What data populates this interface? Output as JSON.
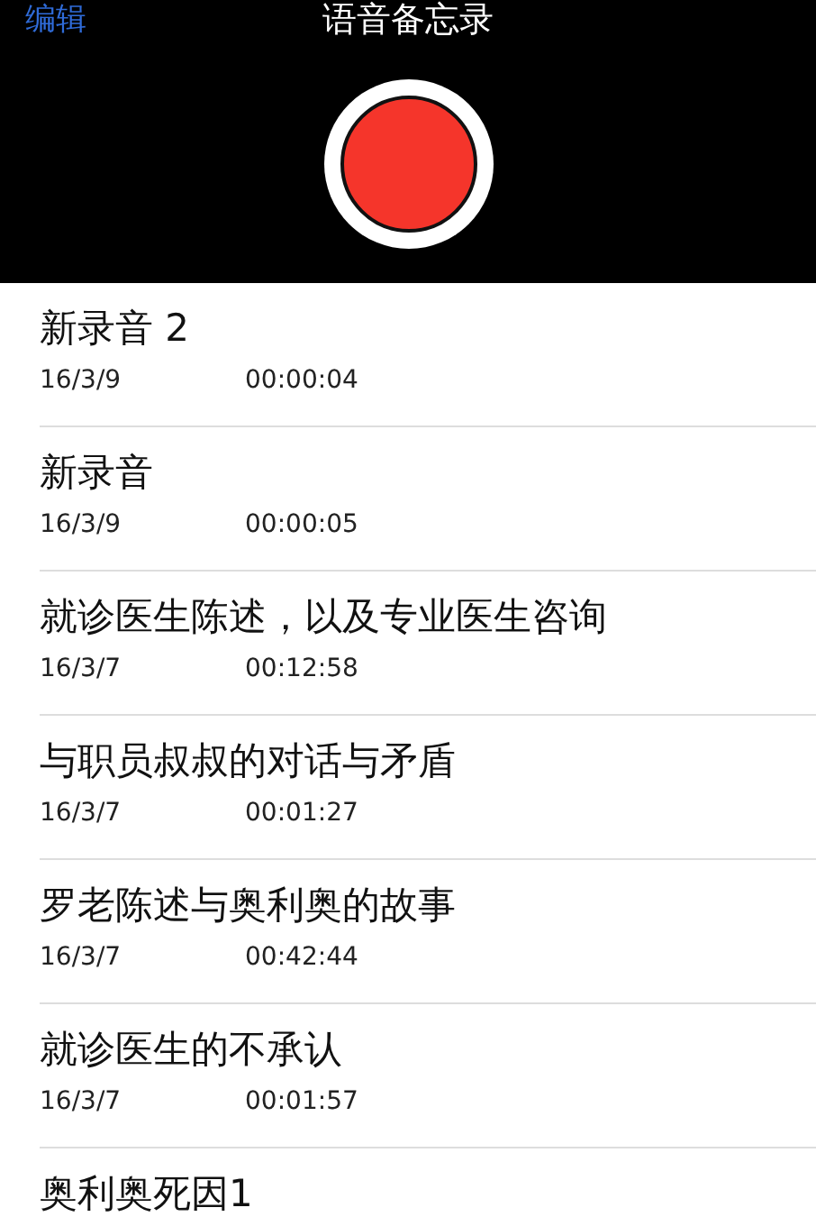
{
  "header": {
    "edit": "编辑",
    "title": "语音备忘录"
  },
  "recordings": [
    {
      "title": "新录音 2",
      "date": "16/3/9",
      "duration": "00:00:04"
    },
    {
      "title": "新录音",
      "date": "16/3/9",
      "duration": "00:00:05"
    },
    {
      "title": "就诊医生陈述，以及专业医生咨询",
      "date": "16/3/7",
      "duration": "00:12:58"
    },
    {
      "title": "与职员叔叔的对话与矛盾",
      "date": "16/3/7",
      "duration": "00:01:27"
    },
    {
      "title": "罗老陈述与奥利奥的故事",
      "date": "16/3/7",
      "duration": "00:42:44"
    },
    {
      "title": "就诊医生的不承认",
      "date": "16/3/7",
      "duration": "00:01:57"
    },
    {
      "title": "奥利奥死因1"
    }
  ]
}
